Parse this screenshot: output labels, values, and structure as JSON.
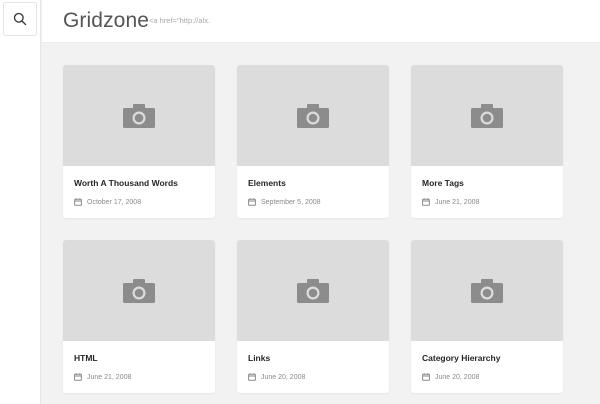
{
  "site": {
    "title": "Gridzone",
    "tagline": "<a href=\"http://alx."
  },
  "icons": {
    "search": "search-icon",
    "thumbnail": "camera-icon",
    "date": "calendar-icon"
  },
  "colors": {
    "thumbnail_bg": "#dcdcdc",
    "camera": "#8c8c8c"
  },
  "posts": [
    {
      "title": "Worth A Thousand Words",
      "date": "October 17, 2008"
    },
    {
      "title": "Elements",
      "date": "September 5, 2008"
    },
    {
      "title": "More Tags",
      "date": "June 21, 2008"
    },
    {
      "title": "HTML",
      "date": "June 21, 2008"
    },
    {
      "title": "Links",
      "date": "June 20, 2008"
    },
    {
      "title": "Category Hierarchy",
      "date": "June 20, 2008"
    }
  ]
}
